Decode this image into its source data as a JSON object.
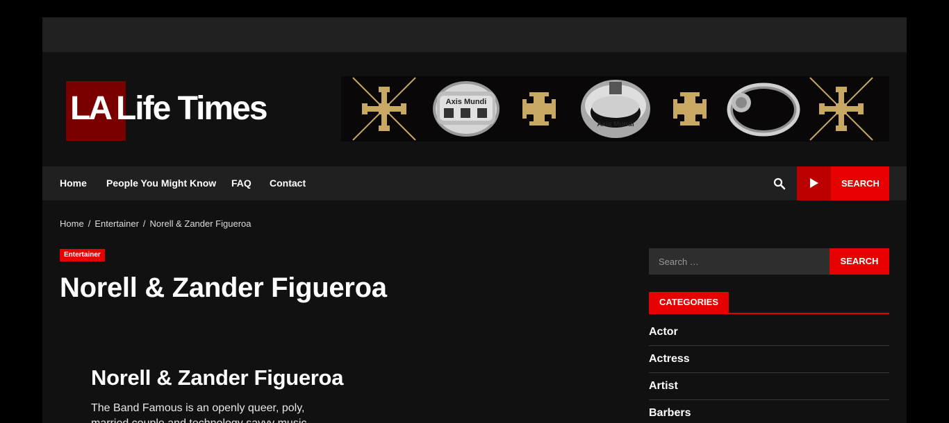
{
  "site": {
    "logo_la": "LA",
    "logo_rest": "Life Times"
  },
  "banner": {
    "ring_text": "Axis Mundi",
    "colors": {
      "gold": "#c8a862",
      "silver": "#cfcfcf",
      "bg": "#0a0708"
    }
  },
  "nav": {
    "items": [
      {
        "label": "Home"
      },
      {
        "label": "People You Might Know"
      },
      {
        "label": "FAQ"
      },
      {
        "label": "Contact"
      }
    ],
    "search_icon": "search-icon",
    "search_button_label": "SEARCH",
    "play_icon": "play-icon"
  },
  "breadcrumb": {
    "items": [
      {
        "label": "Home"
      },
      {
        "label": "Entertainer"
      },
      {
        "label": "Norell & Zander Figueroa"
      }
    ],
    "separator": "/"
  },
  "article": {
    "category": "Entertainer",
    "title": "Norell & Zander Figueroa",
    "subheading": "Norell & Zander Figueroa",
    "intro": "The Band Famous is an openly queer, poly, married couple and technology savvy music"
  },
  "sidebar": {
    "search": {
      "placeholder": "Search …",
      "button_label": "SEARCH"
    },
    "categories": {
      "heading": "CATEGORIES",
      "items": [
        {
          "label": "Actor"
        },
        {
          "label": "Actress"
        },
        {
          "label": "Artist"
        },
        {
          "label": "Barbers"
        }
      ]
    }
  },
  "colors": {
    "accent": "#e60000",
    "accent_dark": "#bb0000",
    "logo_box": "#7a0000",
    "page_bg": "#111111",
    "bar_bg": "#202020"
  }
}
